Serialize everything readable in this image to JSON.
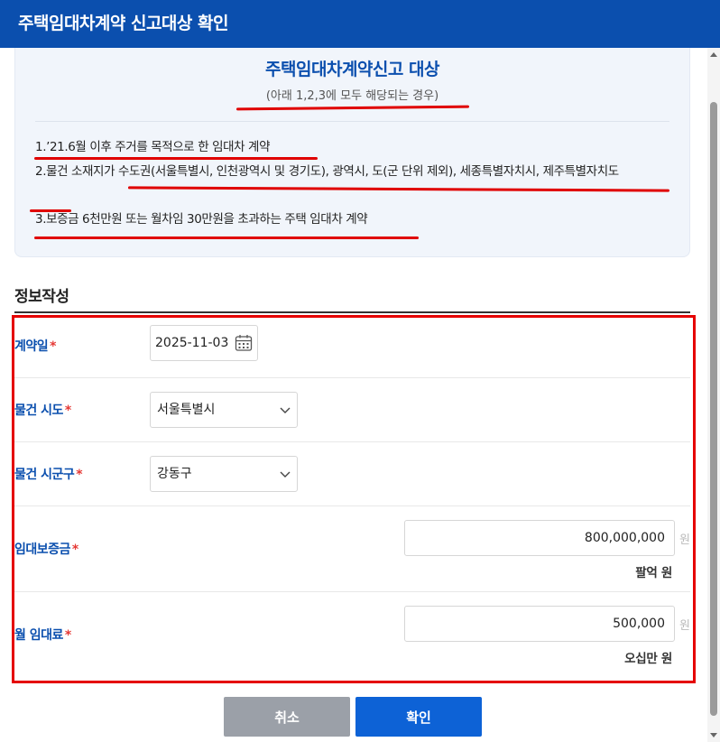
{
  "dialog": {
    "title": "주택임대차계약 신고대상 확인"
  },
  "info": {
    "title": "주택임대차계약신고 대상",
    "subtitle": "(아래 1,2,3에 모두 해당되는 경우)",
    "items": [
      "1.’21.6월 이후 주거를 목적으로 한 임대차 계약",
      "2.물건 소재지가 수도권(서울특별시, 인천광역시 및 경기도), 광역시, 도(군 단위 제외), 세종특별자치시, 제주특별자치도",
      "3.보증금 6천만원 또는 월차임 30만원을 초과하는 주택 임대차 계약"
    ],
    "highlight_color": "#e00000"
  },
  "form": {
    "section_title": "정보작성",
    "required_mark": "*",
    "contract_date": {
      "label": "계약일",
      "value": "2025-11-03"
    },
    "province": {
      "label": "물건 시도",
      "selected": "서울특별시"
    },
    "district": {
      "label": "물건 시군구",
      "selected": "강동구"
    },
    "deposit": {
      "label": "임대보증금",
      "value": "800,000,000",
      "unit": "원",
      "korean": "팔억 원"
    },
    "monthly_rent": {
      "label": "월 임대료",
      "value": "500,000",
      "unit": "원",
      "korean": "오십만 원"
    }
  },
  "buttons": {
    "cancel": "취소",
    "confirm": "확인"
  },
  "colors": {
    "header": "#0b4fae",
    "accent": "#0d62d6",
    "required": "#e53935",
    "outline": "#e50000",
    "cancel": "#9ba0a8"
  },
  "icons": [
    "calendar-icon",
    "chevron-down-icon",
    "scroll-up-arrow-icon",
    "scroll-down-arrow-icon"
  ]
}
